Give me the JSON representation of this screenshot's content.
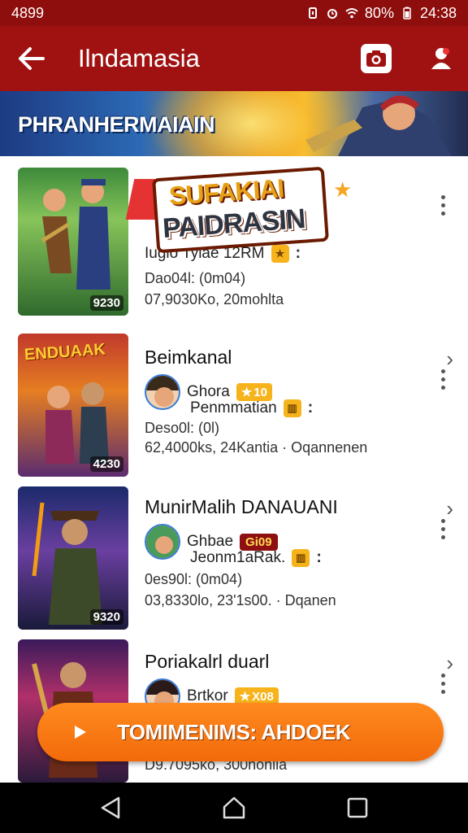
{
  "status_bar": {
    "left": "4899",
    "battery": "80%",
    "time": "24:38"
  },
  "app_bar": {
    "title": "Ilndamasia",
    "back_icon": "arrow-left-icon",
    "camera_icon": "camera-icon",
    "profile_icon": "profile-icon"
  },
  "banner": {
    "text": "PHRANHERMAIAIN"
  },
  "promo": {
    "line1": "SUFAKIAI",
    "line2": "PAIDRASIN"
  },
  "items": [
    {
      "title": "",
      "meta_text": "Iugio Tyiae 12RM",
      "sub1": "Dao04l: (0m04)",
      "sub2": "07,9030Ko, 20mohlta",
      "thumb_badge": "9230"
    },
    {
      "title": "Beimkanal",
      "poster_title": "ENDUAAK",
      "user": "Ghora",
      "star_badge": "10",
      "meta2": "Penmmatian",
      "sub1": "Deso0l: (0l)",
      "sub2": "62,4000ks, 24Kantia · Oqannenen",
      "thumb_badge": "4230"
    },
    {
      "title": "MunirMalih DANAUANI",
      "user": "Ghbae",
      "red_badge": "Gi09",
      "meta2": "Jeonm1aRak.",
      "sub1": "0es90l: (0m04)",
      "sub2": "03,8330lo, 23'1s00. · Dqanen",
      "thumb_badge": "9320"
    },
    {
      "title": "Poriakalrl duarl",
      "user": "Brtkor",
      "star_badge": "X08",
      "sub2": "D9.7095ko, 300nohlia"
    }
  ],
  "cta": {
    "label": "TOMIMENIMS: AHDOEK"
  },
  "nav": {
    "back_icon": "nav-back-icon",
    "home_icon": "nav-home-icon",
    "recents_icon": "nav-recents-icon"
  }
}
